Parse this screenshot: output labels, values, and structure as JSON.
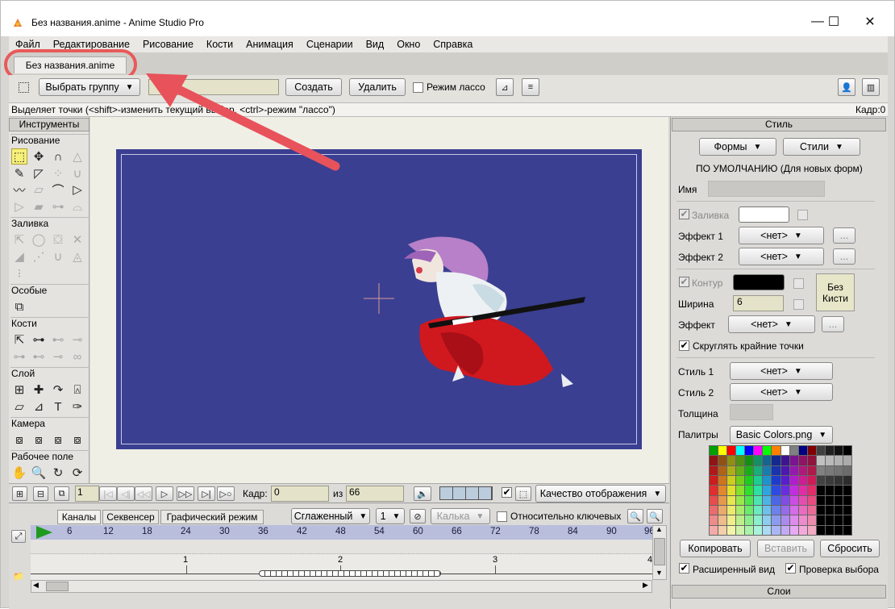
{
  "window": {
    "title": "Без названия.anime - Anime Studio Pro",
    "minimize": "—",
    "maximize": "☐",
    "close": "✕"
  },
  "menu": [
    "Файл",
    "Редактирование",
    "Рисование",
    "Кости",
    "Анимация",
    "Сценарии",
    "Вид",
    "Окно",
    "Справка"
  ],
  "doc_tab": "Без названия.anime",
  "toolbar": {
    "select_group": "Выбрать группу",
    "create": "Создать",
    "delete": "Удалить",
    "lasso_mode": "Режим лассо"
  },
  "status": {
    "hint": "Выделяет точки (<shift>-изменить текущий выбор, <ctrl>-режим \"лассо\")",
    "frame": "Кадр:0"
  },
  "tools": {
    "header": "Инструменты",
    "sections": [
      "Рисование",
      "Заливка",
      "Особые",
      "Кости",
      "Слой",
      "Камера",
      "Рабочее поле"
    ]
  },
  "style": {
    "header": "Стиль",
    "shapes": "Формы",
    "styles": "Стили",
    "default_label": "ПО УМОЛЧАНИЮ (Для новых форм)",
    "name_label": "Имя",
    "fill_label": "Заливка",
    "effect1_label": "Эффект 1",
    "effect2_label": "Эффект 2",
    "none": "<нет>",
    "ellipsis": "...",
    "stroke_label": "Контур",
    "width_label": "Ширина",
    "width_value": "6",
    "no_brush": "Без Кисти",
    "effect_label": "Эффект",
    "round_caps": "Скруглять крайние точки",
    "style1_label": "Стиль 1",
    "style2_label": "Стиль 2",
    "thickness_label": "Толщина",
    "palettes_label": "Палитры",
    "palette_value": "Basic Colors.png",
    "copy": "Копировать",
    "paste": "Вставить",
    "reset": "Сбросить",
    "extended_view": "Расширенный вид",
    "check_selection": "Проверка выбора",
    "layers": "Слои",
    "fill_color": "#ffffff",
    "stroke_color": "#000000"
  },
  "playback": {
    "frame_label": "Кадр:",
    "frame_value": "0",
    "of_label": "из",
    "of_value": "66",
    "quality": "Качество отображения",
    "field_value": "1"
  },
  "timeline": {
    "tabs": [
      "Каналы",
      "Секвенсер",
      "Графический режим"
    ],
    "smooth": "Сглаженный",
    "step": "1",
    "onion": "Калька",
    "relative_keys": "Относительно ключевых",
    "ruler": [
      "6",
      "12",
      "18",
      "24",
      "30",
      "36",
      "42",
      "48",
      "54",
      "60",
      "66",
      "72",
      "78",
      "84",
      "90",
      "96"
    ],
    "seconds": [
      "1",
      "2",
      "3",
      "4"
    ]
  },
  "canvas": {
    "background": "#3b3f91",
    "stage_bg": "#f0efe6"
  }
}
